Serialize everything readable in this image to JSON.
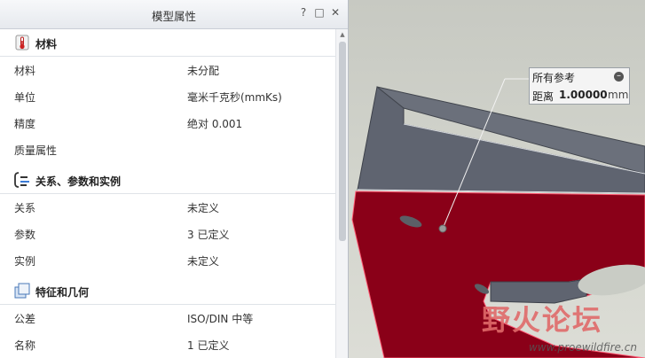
{
  "panel": {
    "title": "模型属性",
    "window_buttons": {
      "help": "?",
      "minimize": "–",
      "maximize": "□",
      "close": "✕"
    },
    "sections": {
      "material": {
        "title": "材料",
        "rows": [
          {
            "key": "材料",
            "value": "未分配"
          },
          {
            "key": "单位",
            "value": "毫米千克秒(mmKs)"
          },
          {
            "key": "精度",
            "value": "绝对 0.001"
          },
          {
            "key": "质量属性",
            "value": ""
          }
        ]
      },
      "relations": {
        "title": "关系、参数和实例",
        "rows": [
          {
            "key": "关系",
            "value": "未定义"
          },
          {
            "key": "参数",
            "value": "3 已定义"
          },
          {
            "key": "实例",
            "value": "未定义"
          }
        ]
      },
      "features": {
        "title": "特征和几何",
        "rows": [
          {
            "key": "公差",
            "value": "ISO/DIN 中等"
          },
          {
            "key": "名称",
            "value": "1 已定义"
          }
        ]
      }
    }
  },
  "viewport": {
    "reference_box": {
      "title": "所有参考",
      "collapse_symbol": "–",
      "distance_label": "距离",
      "distance_value": "1.00000",
      "distance_unit": "mm"
    },
    "watermark": {
      "text": "野火论坛",
      "url": "www.proewildfire.cn"
    }
  },
  "colors": {
    "selection_red": "#8a0018",
    "part_gray": "#5f6470",
    "viewport_bg": "#cfd1ca"
  },
  "icons": {
    "material": "thermometer-icon",
    "relations": "relations-icon",
    "features": "features-icon"
  }
}
